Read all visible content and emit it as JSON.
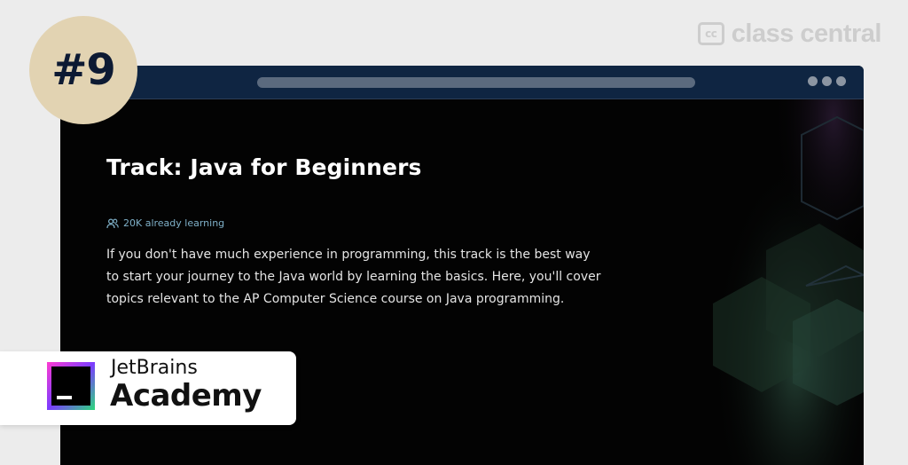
{
  "brand": {
    "badge_text": "cc",
    "name": "class central"
  },
  "rank": {
    "label": "#9"
  },
  "browser": {
    "window_controls": [
      "dot",
      "dot",
      "dot"
    ]
  },
  "course": {
    "title": "Track: Java for Beginners",
    "learners_text": "20K already learning",
    "learners_icon": "users-icon",
    "description": "If you don't have much experience in programming, this track is the best way to start your journey to the Java world by learning the basics. Here, you'll cover topics relevant to the AP Computer Science course on Java programming."
  },
  "provider": {
    "line1": "JetBrains",
    "line2": "Academy",
    "logo_icon": "jetbrains-logo-icon"
  },
  "colors": {
    "background": "#ececec",
    "browser_bar": "#0f2542",
    "browser_body": "#030303",
    "rank_badge": "#e2d3b2",
    "rank_text": "#0d1a33",
    "learners_text": "#7fb0c8"
  }
}
